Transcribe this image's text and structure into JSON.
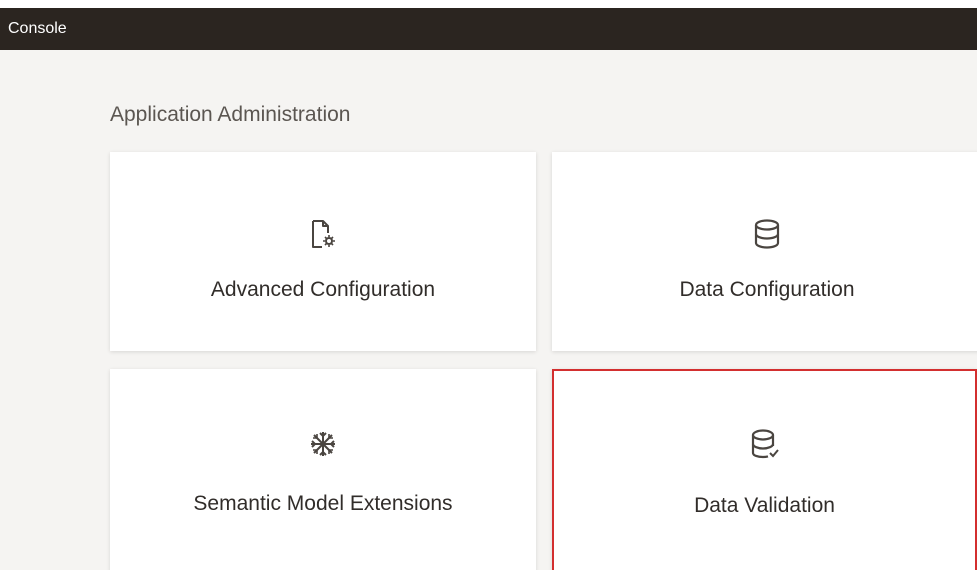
{
  "header": {
    "title": "Console"
  },
  "section": {
    "title": "Application Administration"
  },
  "cards": [
    {
      "label": "Advanced Configuration",
      "icon": "document-settings-icon",
      "selected": false
    },
    {
      "label": "Data Configuration",
      "icon": "database-icon",
      "selected": false
    },
    {
      "label": "Semantic Model Extensions",
      "icon": "snowflake-icon",
      "selected": false
    },
    {
      "label": "Data Validation",
      "icon": "database-check-icon",
      "selected": true
    }
  ],
  "colors": {
    "titlebar": "#2b2520",
    "selected_border": "#d32f2f",
    "icon": "#4a4540"
  }
}
